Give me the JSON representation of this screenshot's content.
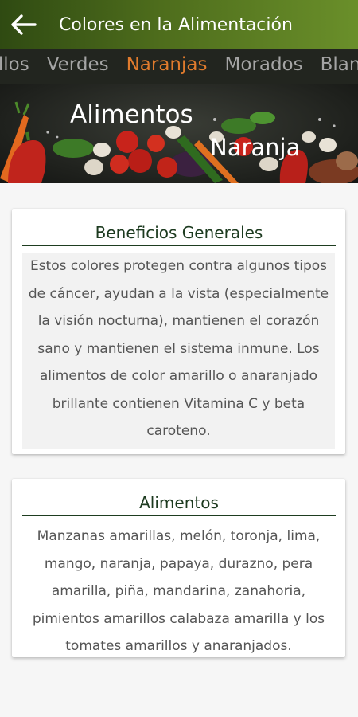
{
  "appbar": {
    "title": "Colores en la Alimentación",
    "back_icon": "arrow-left-icon",
    "gradient": [
      "#2f4a12",
      "#6a8f2a"
    ]
  },
  "tabs": {
    "items": [
      {
        "label": "rillos"
      },
      {
        "label": "Verdes"
      },
      {
        "label": "Naranjas",
        "active": true
      },
      {
        "label": "Morados"
      },
      {
        "label": "Blan"
      }
    ],
    "active_color": "#e07b2d"
  },
  "banner": {
    "line1": "Alimentos",
    "line2": "Naranja"
  },
  "cards": [
    {
      "title": "Beneficios Generales",
      "body": "Estos colores protegen contra algunos tipos de cáncer, ayudan a la vista (especialmente la visión nocturna), mantienen el corazón sano y mantienen el sistema inmune. Los alimentos de color amarillo o anaranjado brillante contienen Vitamina C y beta caroteno."
    },
    {
      "title": "Alimentos",
      "body": "Manzanas amarillas, melón, toronja, lima, mango, naranja, papaya, durazno, pera amarilla,  piña, mandarina, zanahoria, pimientos amarillos calabaza amarilla y los tomates amarillos y anaranjados."
    }
  ]
}
